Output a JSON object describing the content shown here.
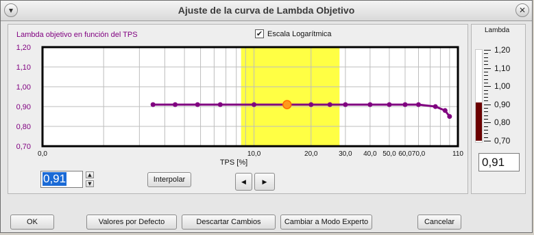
{
  "window": {
    "title": "Ajuste de la curva de Lambda Objetivo"
  },
  "chart_title": "Lambda objetivo en función del TPS",
  "log_scale": {
    "label": "Escala Logarítmica",
    "checked": true
  },
  "chart_data": {
    "type": "line",
    "xlabel": "TPS [%]",
    "ylabel": "",
    "x_scale": "log",
    "xlim": [
      0,
      110
    ],
    "ylim": [
      0.7,
      1.2
    ],
    "x_ticks": [
      "0,0",
      "10,0",
      "20,0",
      "30,0",
      "40,0",
      "50,0",
      "60,0",
      "70,0",
      "110"
    ],
    "y_ticks": [
      "1,20",
      "1,10",
      "1,00",
      "0,90",
      "0,80",
      "0,70"
    ],
    "highlight_x_range": [
      8.5,
      28
    ],
    "highlight_color": "#ffff44",
    "line_color": "#800080",
    "selected_point_index": 5,
    "series": [
      {
        "x": [
          2.5,
          3.5,
          4.8,
          6.5,
          10,
          15,
          20,
          25,
          30,
          40,
          50,
          60,
          70,
          85,
          95,
          100
        ],
        "y": [
          0.91,
          0.91,
          0.91,
          0.91,
          0.91,
          0.91,
          0.91,
          0.91,
          0.91,
          0.91,
          0.91,
          0.91,
          0.91,
          0.9,
          0.88,
          0.85
        ]
      }
    ]
  },
  "value_input": {
    "value": "0,91"
  },
  "interpolar_label": "Interpolar",
  "nav": {
    "prev_label": "◀",
    "next_label": "▶"
  },
  "gauge": {
    "title": "Lambda",
    "labels": [
      "1,20",
      "1,10",
      "1,00",
      "0,90",
      "0,80",
      "0,70"
    ],
    "min": 0.7,
    "max": 1.2,
    "value": 0.91,
    "fill_color": "#6b0000",
    "readout": "0,91"
  },
  "buttons": {
    "ok": "OK",
    "defaults": "Valores por Defecto",
    "discard": "Descartar Cambios",
    "expert": "Cambiar a Modo Experto",
    "cancel": "Cancelar"
  }
}
